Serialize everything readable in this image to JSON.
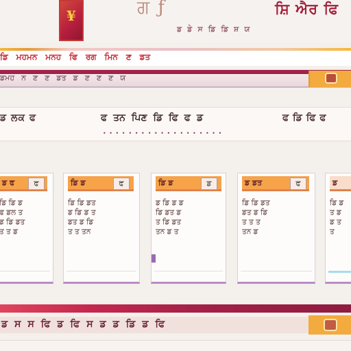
{
  "header": {
    "logo_mark": "¥",
    "brand": "ਗ ƒ",
    "title": "ਸ਼ਿ ਐਰ ਫਿ",
    "links": [
      "ਡ",
      "ਡੇ",
      "ਸ",
      "ਡਿ",
      "ਡਿ",
      "ਸ਼",
      "ਯ"
    ]
  },
  "nav": {
    "items": [
      "ਡਿ",
      "ਮਹਮਨ",
      "ਮਨਹ",
      "ਫਿ",
      "ਰਗ",
      "ਮਿਨ",
      "ਣ",
      "ਡਤ"
    ]
  },
  "subbar": {
    "items": [
      "ਡਮਹ",
      "ਨ",
      "ਣ",
      "ਣ",
      "ਡਤ",
      "ਡ",
      "ਣ",
      "ਣ",
      "ਣ",
      "ਯ"
    ]
  },
  "filter": {
    "label": "ਡ ਲਕ ਫ",
    "items": [
      "ਫ",
      "ਤਨ",
      "ਪਿਣ",
      "ਡਿ",
      "ਫਿ",
      "ਫ",
      "ਡ"
    ],
    "right": [
      "ਫ",
      "ਡਿ",
      "ਫਿ",
      "ਫ"
    ],
    "dots": [
      "• • • •",
      "• • •",
      "• • • • •",
      "• • •",
      "• • • •"
    ]
  },
  "cards": [
    {
      "head": "ਡ ਫ",
      "badge": "ਫ",
      "lines": [
        "ਡਿ ਡਿ ਡ",
        "ਫ ਡਲ ਤ",
        "ਡ ਡਿ ਡਤ",
        "ਤ ਤ ਡ"
      ]
    },
    {
      "head": "ਡਿ ਡ",
      "badge": "ਫ",
      "lines": [
        "ਡਿ ਡਿ ਡਤ",
        "ਡ ਡਿ ਡ ਤ",
        "ਡਤ ਡ ਡਿ",
        "ਤ ਤ ਤਨ"
      ]
    },
    {
      "head": "ਡਿ ਡ",
      "badge": "ਡ",
      "lines": [
        "ਡ ਡਿ ਡ ਡ",
        "ਡਿ ਡਤ ਡ",
        "ਤ ਡਿ ਡਤ",
        "ਤਨ ਡ ਤ"
      ]
    },
    {
      "head": "ਡ ਡਤ",
      "badge": "ਫ",
      "lines": [
        "ਡਿ ਡਿ ਡਤ",
        "ਡਤ ਡ ਡਿ",
        "ਤ ਤ ਤ",
        "ਤਨ ਡ"
      ]
    },
    {
      "head": "ਡ",
      "badge": "ਫ",
      "lines": [
        "ਡਿ ਡ",
        "ਤ ਡ",
        "ਡ ਤ",
        "ਤ"
      ]
    }
  ],
  "footer": {
    "items": [
      "ਡ",
      "ਸ",
      "ਸ",
      "ਫਿ",
      "ਡ",
      "ਫਿ",
      "ਸ",
      "ਡ",
      "ਡ",
      "ਡਿ",
      "ਡ",
      "ਫਿ"
    ]
  },
  "colors": {
    "brand": "#a3203c",
    "accent": "#f3aa3e",
    "band": "#a0234c"
  }
}
